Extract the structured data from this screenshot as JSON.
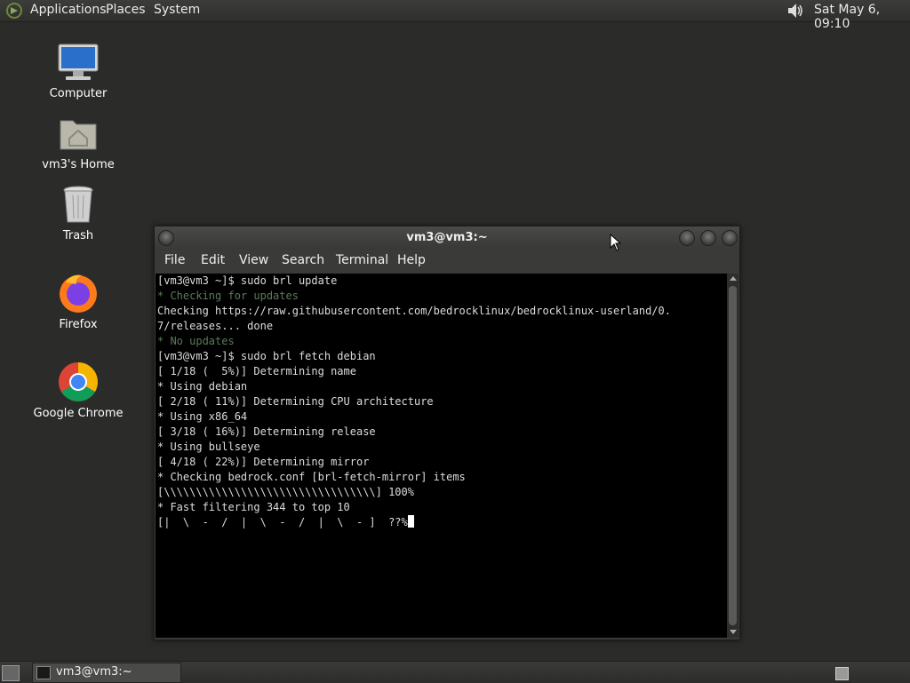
{
  "top_panel": {
    "menus": [
      "Applications",
      "Places",
      "System"
    ],
    "clock": "Sat May  6, 09:10",
    "volume_icon": "speaker-icon"
  },
  "desktop_icons": [
    {
      "label": "Computer",
      "icon": "computer-icon"
    },
    {
      "label": "vm3's Home",
      "icon": "home-folder-icon"
    },
    {
      "label": "Trash",
      "icon": "trash-icon"
    },
    {
      "label": "Firefox",
      "icon": "firefox-icon"
    },
    {
      "label": "Google Chrome",
      "icon": "chrome-icon"
    }
  ],
  "window": {
    "title": "vm3@vm3:~",
    "menus": [
      "File",
      "Edit",
      "View",
      "Search",
      "Terminal",
      "Help"
    ],
    "terminal_lines": [
      "[vm3@vm3 ~]$ sudo brl update",
      "* Checking for updates",
      "Checking https://raw.githubusercontent.com/bedrocklinux/bedrocklinux-userland/0.",
      "7/releases... done",
      "* No updates",
      "[vm3@vm3 ~]$ sudo brl fetch debian",
      "[ 1/18 (  5%)] Determining name",
      "* Using debian",
      "[ 2/18 ( 11%)] Determining CPU architecture",
      "* Using x86_64",
      "[ 3/18 ( 16%)] Determining release",
      "* Using bullseye",
      "[ 4/18 ( 22%)] Determining mirror",
      "* Checking bedrock.conf [brl-fetch-mirror] items",
      "[\\\\\\\\\\\\\\\\\\\\\\\\\\\\\\\\\\\\\\\\\\\\\\\\\\\\\\\\\\\\\\\\\\] 100%",
      "* Fast filtering 344 to top 10",
      "[|  \\  -  /  |  \\  -  /  |  \\  - ]  ??%"
    ]
  },
  "taskbar": {
    "window_button": "vm3@vm3:~"
  },
  "colors": {
    "desktop_bg": "#2b2b29",
    "terminal_bg": "#000000",
    "terminal_fg": "#dcdcdc",
    "dim_green": "#5a7a5a"
  }
}
